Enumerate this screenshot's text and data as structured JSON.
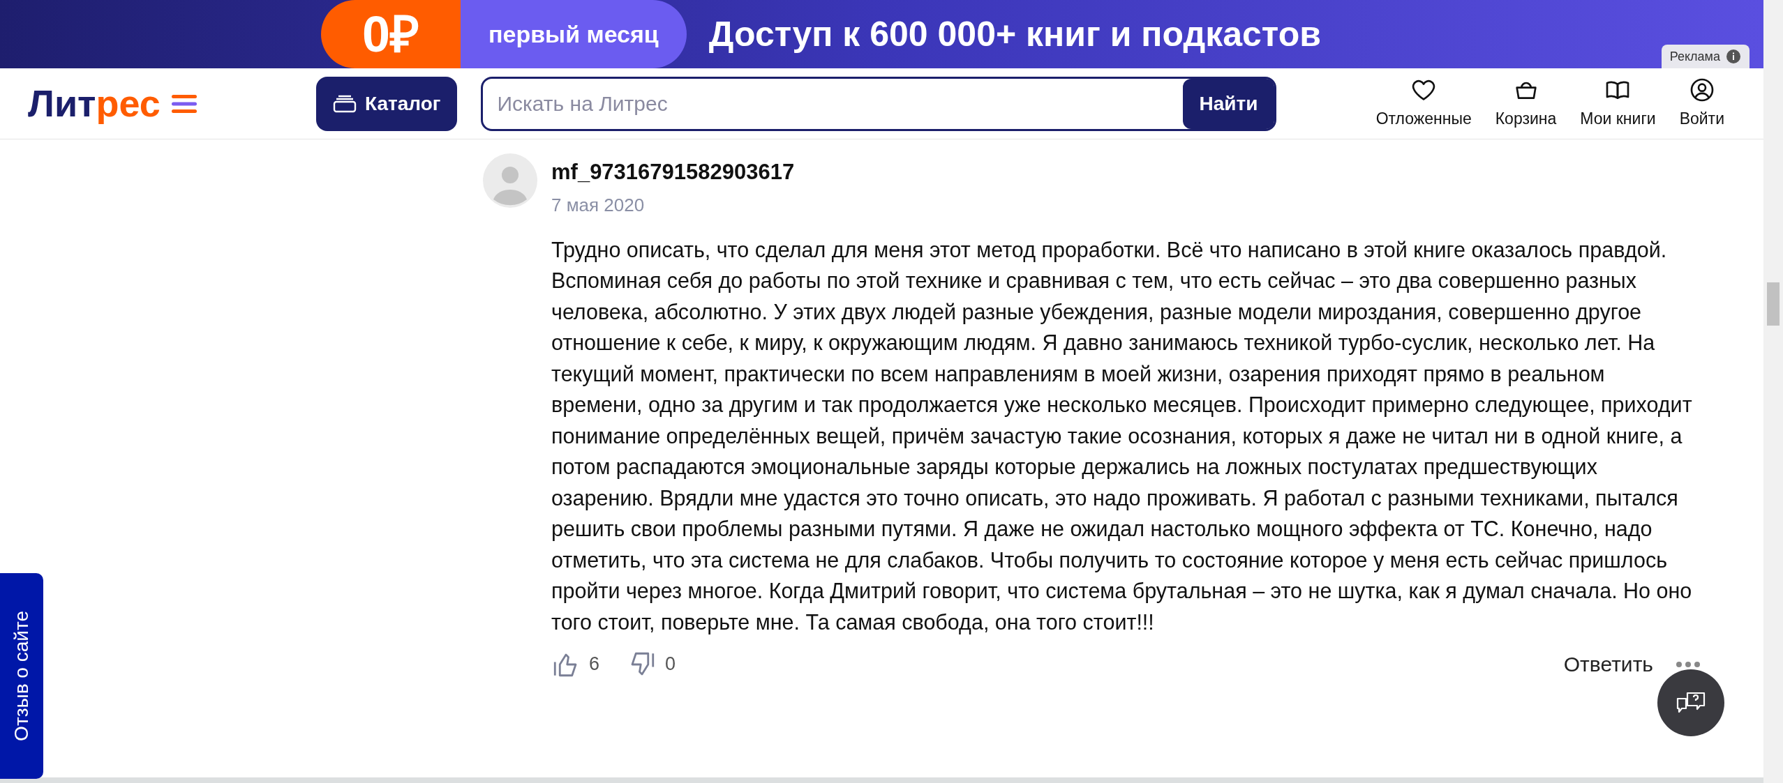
{
  "banner": {
    "price": "0₽",
    "offer": "первый месяц",
    "headline": "Доступ к 600 000+ книг и подкастов",
    "ad_label": "Реклама"
  },
  "header": {
    "logo_parts": [
      {
        "text": "Лит",
        "color": "#1b1f6b"
      },
      {
        "text": "рес",
        "color": "#ff5c00"
      }
    ],
    "catalog_button": "Каталог",
    "search": {
      "placeholder": "Искать на Литрес",
      "button": "Найти"
    },
    "nav": [
      {
        "kind": "heart",
        "label": "Отложенные"
      },
      {
        "kind": "basket",
        "label": "Корзина"
      },
      {
        "kind": "book",
        "label": "Мои книги"
      },
      {
        "kind": "user",
        "label": "Войти"
      }
    ]
  },
  "review": {
    "author": "mf_97316791582903617",
    "date": "7 мая 2020",
    "text": "Трудно описать, что сделал для меня этот метод проработки. Всё что написано в этой книге оказалось правдой. Вспоминая себя до работы по этой технике и сравнивая с тем, что есть сейчас – это два совершенно разных человека, абсолютно. У этих двух людей разные убеждения, разные модели мироздания, совершенно другое отношение к себе, к миру, к окружающим людям. Я давно занимаюсь техникой турбо-суслик, несколько лет. На текущий момент, практически по всем направлениям в моей жизни, озарения приходят прямо в реальном времени, одно за другим и так продолжается уже несколько месяцев. Происходит примерно следующее, приходит понимание определённых вещей, причём зачастую такие осознания, которых я даже не читал ни в одной книге, а потом распадаются эмоциональные заряды которые держались на ложных постулатах предшествующих озарению. Врядли мне удастся это точно описать, это надо проживать. Я работал с разными техниками, пытался решить свои проблемы разными путями. Я даже не ожидал настолько мощного эффекта от ТС. Конечно, надо отметить, что эта система не для слабаков. Чтобы получить то состояние которое у меня есть сейчас пришлось пройти через многое. Когда Дмитрий говорит, что система брутальная – это не шутка, как я думал сначала. Но оно того стоит, поверьте мне. Та самая свобода, она того стоит!!!",
    "likes": "6",
    "dislikes": "0",
    "reply": "Ответить"
  },
  "feedback_tab": "Отзыв о сайте"
}
